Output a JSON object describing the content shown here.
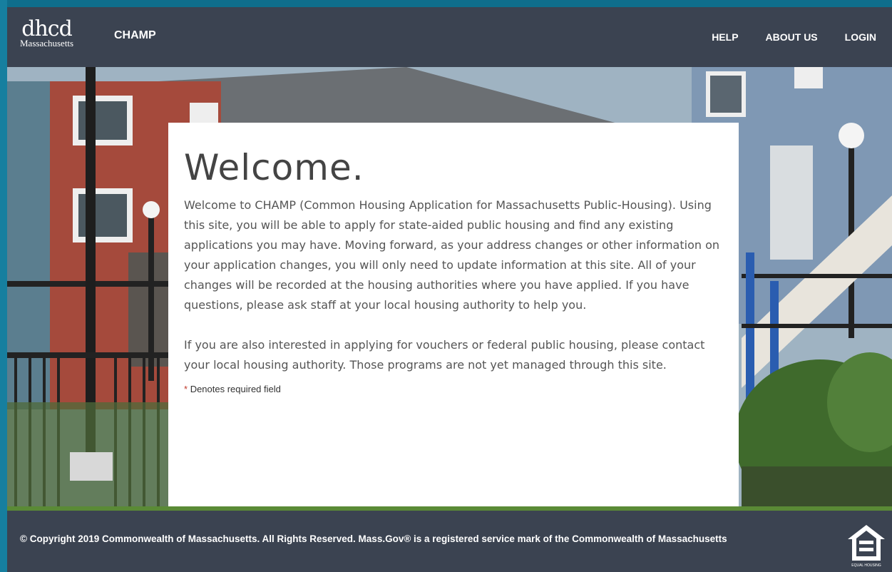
{
  "header": {
    "logo_main": "dhcd",
    "logo_sub": "Massachusetts",
    "brand": "CHAMP",
    "nav": [
      "HELP",
      "ABOUT US",
      "LOGIN"
    ]
  },
  "card": {
    "heading": "Welcome.",
    "paragraph1": "Welcome to CHAMP (Common Housing Application for Massachusetts Public-Housing). Using this site, you will be able to apply for state-aided public housing and find any existing applications you may have. Moving forward, as your address changes or other information on your application changes, you will only need to update information at this site. All of your changes will be recorded at the housing authorities where you have applied. If you have questions, please ask staff at your local housing authority to help you.",
    "paragraph2": "If you are also interested in applying for vouchers or federal public housing, please contact your local housing authority. Those programs are not yet managed through this site.",
    "required_star": "*",
    "required_note": "Denotes required field"
  },
  "footer": {
    "copyright": "© Copyright 2019 Commonwealth of Massachusetts. All Rights Reserved. Mass.Gov® is a registered service mark of the Commonwealth of Massachusetts",
    "eho_text": "EQUAL HOUSING"
  },
  "colors": {
    "header_bg": "#3b4351",
    "footer_bg": "#3b4351",
    "accent_green": "#5a8a36",
    "frame_teal": "#167f9f"
  }
}
